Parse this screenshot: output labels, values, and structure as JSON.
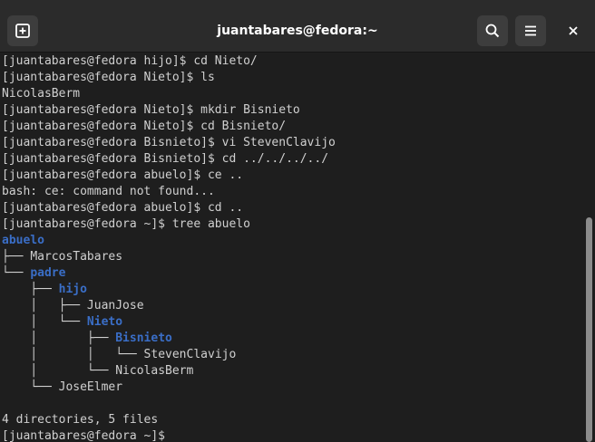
{
  "window": {
    "title": "juantabares@fedora:~",
    "icons": {
      "new_tab": "new-tab-icon",
      "search": "search-icon",
      "menu": "hamburger-menu-icon",
      "close": "close-icon"
    }
  },
  "colors": {
    "background": "#1e1e1e",
    "titlebar": "#2b2b2b",
    "text": "#d0d0d0",
    "directory": "#3a6ec7"
  },
  "terminal": {
    "lines": [
      {
        "text": "[juantabares@fedora hijo]$ cd Nieto/",
        "kind": "normal"
      },
      {
        "text": "[juantabares@fedora Nieto]$ ls",
        "kind": "normal"
      },
      {
        "text": "NicolasBerm",
        "kind": "normal"
      },
      {
        "text": "[juantabares@fedora Nieto]$ mkdir Bisnieto",
        "kind": "normal"
      },
      {
        "text": "[juantabares@fedora Nieto]$ cd Bisnieto/",
        "kind": "normal"
      },
      {
        "text": "[juantabares@fedora Bisnieto]$ vi StevenClavijo",
        "kind": "normal"
      },
      {
        "text": "[juantabares@fedora Bisnieto]$ cd ../../../../",
        "kind": "normal"
      },
      {
        "text": "[juantabares@fedora abuelo]$ ce ..",
        "kind": "normal"
      },
      {
        "text": "bash: ce: command not found...",
        "kind": "normal"
      },
      {
        "text": "[juantabares@fedora abuelo]$ cd ..",
        "kind": "normal"
      },
      {
        "text": "[juantabares@fedora ~]$ tree abuelo",
        "kind": "normal"
      },
      {
        "prefix": "",
        "name": "abuelo",
        "kind": "dir"
      },
      {
        "prefix": "├── ",
        "name": "MarcosTabares",
        "kind": "file"
      },
      {
        "prefix": "└── ",
        "name": "padre",
        "kind": "dir"
      },
      {
        "prefix": "    ├── ",
        "name": "hijo",
        "kind": "dir"
      },
      {
        "prefix": "    │   ├── ",
        "name": "JuanJose",
        "kind": "file"
      },
      {
        "prefix": "    │   └── ",
        "name": "Nieto",
        "kind": "dir"
      },
      {
        "prefix": "    │       ├── ",
        "name": "Bisnieto",
        "kind": "dir"
      },
      {
        "prefix": "    │       │   └── ",
        "name": "StevenClavijo",
        "kind": "file"
      },
      {
        "prefix": "    │       └── ",
        "name": "NicolasBerm",
        "kind": "file"
      },
      {
        "prefix": "    └── ",
        "name": "JoseElmer",
        "kind": "file"
      },
      {
        "text": "",
        "kind": "normal"
      },
      {
        "text": "4 directories, 5 files",
        "kind": "normal"
      },
      {
        "text": "[juantabares@fedora ~]$ ",
        "kind": "normal"
      }
    ]
  }
}
